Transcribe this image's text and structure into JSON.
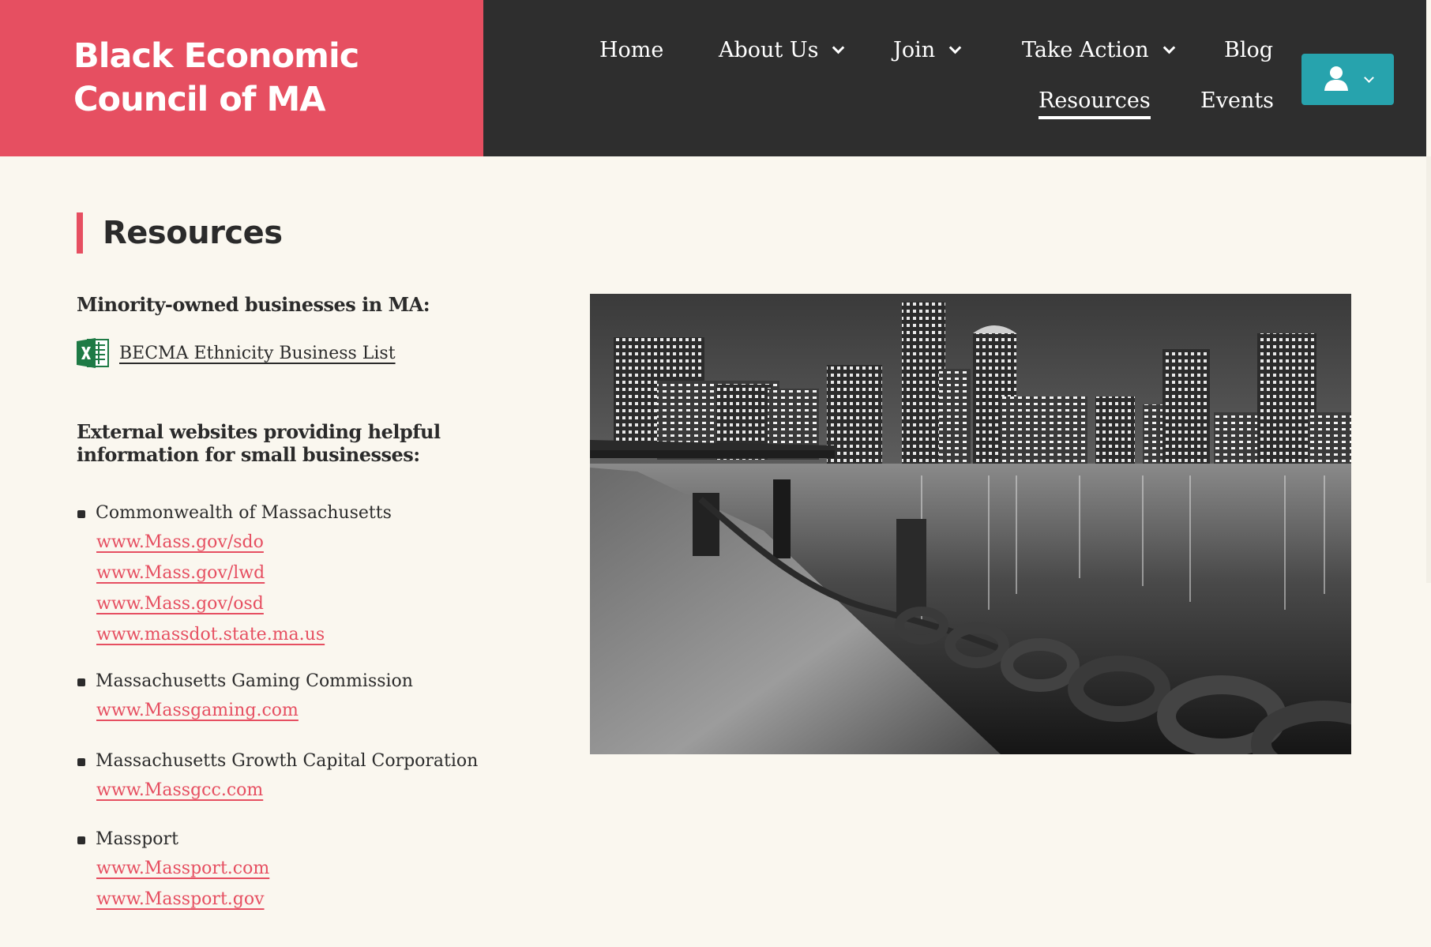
{
  "header": {
    "brand": "Black Economic Council of MA",
    "nav": {
      "home": "Home",
      "about": "About Us",
      "join": "Join",
      "take_action": "Take Action",
      "blog": "Blog",
      "resources": "Resources",
      "events": "Events"
    },
    "user_menu_icon": "user-icon"
  },
  "main": {
    "title": "Resources",
    "minority_heading": "Minority-owned businesses in MA:",
    "excel_icon": "excel-file-icon",
    "excel_link": "BECMA Ethnicity Business List",
    "external_heading": "External websites providing helpful information for small businesses:",
    "groups": [
      {
        "name": "Commonwealth of Massachusetts",
        "links": [
          "www.Mass.gov/sdo",
          "www.Mass.gov/lwd",
          "www.Mass.gov/osd",
          "www.massdot.state.ma.us"
        ]
      },
      {
        "name": "Massachusetts Gaming Commission",
        "links": [
          "www.Massgaming.com"
        ]
      },
      {
        "name": "Massachusetts Growth Capital Corporation",
        "links": [
          "www.Massgcc.com"
        ]
      },
      {
        "name": "Massport",
        "links": [
          "www.Massport.com",
          "www.Massport.gov"
        ]
      }
    ],
    "photo_icon": "city-skyline-photo"
  },
  "colors": {
    "brand_red": "#e64f61",
    "header_dark": "#2e2e2e",
    "teal": "#27a3ad",
    "background": "#faf7ef"
  }
}
